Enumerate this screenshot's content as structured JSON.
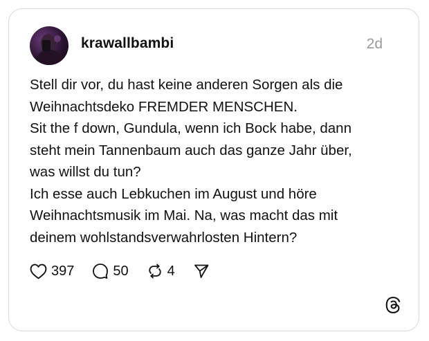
{
  "post": {
    "username": "krawallbambi",
    "time": "2d",
    "text_lines": [
      "Stell dir vor, du hast keine anderen Sorgen als die",
      "Weihnachtsdeko FREMDER MENSCHEN.",
      "Sit the f down, Gundula, wenn ich Bock habe, dann",
      "steht mein Tannenbaum auch das ganze Jahr über,",
      "was willst du tun?",
      "Ich esse auch Lebkuchen im August und höre",
      "Weihnachtsmusik im Mai. Na, was macht das mit",
      "deinem wohlstandsverwahrlosten Hintern?"
    ]
  },
  "actions": {
    "likes": "397",
    "replies": "50",
    "reposts": "4"
  },
  "icons": {
    "like": "heart-icon",
    "reply": "comment-bubble-icon",
    "repost": "repost-icon",
    "share": "send-icon",
    "brand": "threads-logo-icon"
  }
}
